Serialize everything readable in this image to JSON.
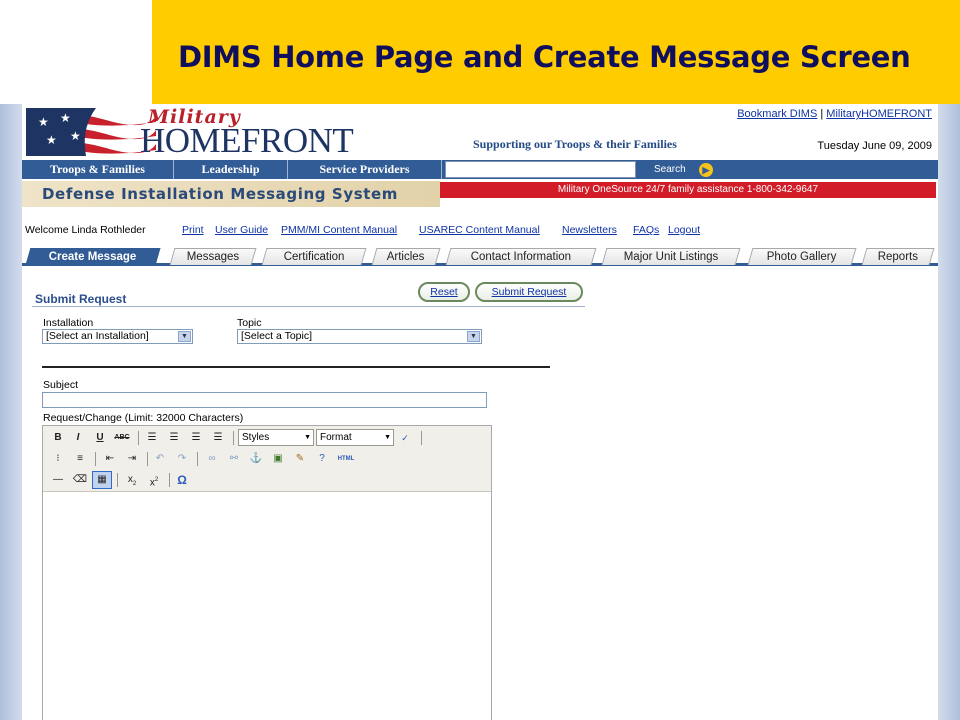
{
  "slide": {
    "title": "DIMS Home Page  and Create Message Screen"
  },
  "header": {
    "logo_top": "Military",
    "logo_main": "HOMEFRONT",
    "tagline": "Supporting our Troops & their Families",
    "bookmark_link": "Bookmark DIMS",
    "link_separator": "|",
    "homefront_link": "MilitaryHOMEFRONT",
    "date": "Tuesday June 09, 2009"
  },
  "nav": {
    "items": [
      "Troops & Families",
      "Leadership",
      "Service Providers"
    ],
    "search_label": "Search",
    "search_go": "▶"
  },
  "system_title": "Defense Installation Messaging System",
  "onesource_banner": "Military OneSource 24/7 family assistance 1-800-342-9647",
  "welcome": {
    "text": "Welcome Linda Rothleder",
    "links": [
      "Print",
      "User Guide",
      "PMM/MI Content Manual",
      "USAREC Content Manual",
      "Newsletters",
      "FAQs",
      "Logout"
    ]
  },
  "tabs": [
    "Create Message",
    "Messages",
    "Certification",
    "Articles",
    "Contact Information",
    "Major Unit Listings",
    "Photo Gallery",
    "Reports"
  ],
  "form": {
    "section_title": "Submit Request",
    "reset_label": "Reset",
    "submit_label": "Submit Request",
    "installation_label": "Installation",
    "installation_value": "[Select an Installation]",
    "topic_label": "Topic",
    "topic_value": "[Select a Topic]",
    "subject_label": "Subject",
    "subject_value": "",
    "request_label": "Request/Change (Limit: 32000 Characters)"
  },
  "editor": {
    "styles_label": "Styles",
    "format_label": "Format",
    "buttons_row1": [
      "B",
      "I",
      "U",
      "ABC"
    ],
    "html_label": "HTML",
    "omega": "Ω"
  },
  "colors": {
    "slide_bar": "#ffcc00",
    "nav_blue": "#315c95",
    "banner_red": "#d21d28",
    "title_navy": "#0f0f5e"
  }
}
